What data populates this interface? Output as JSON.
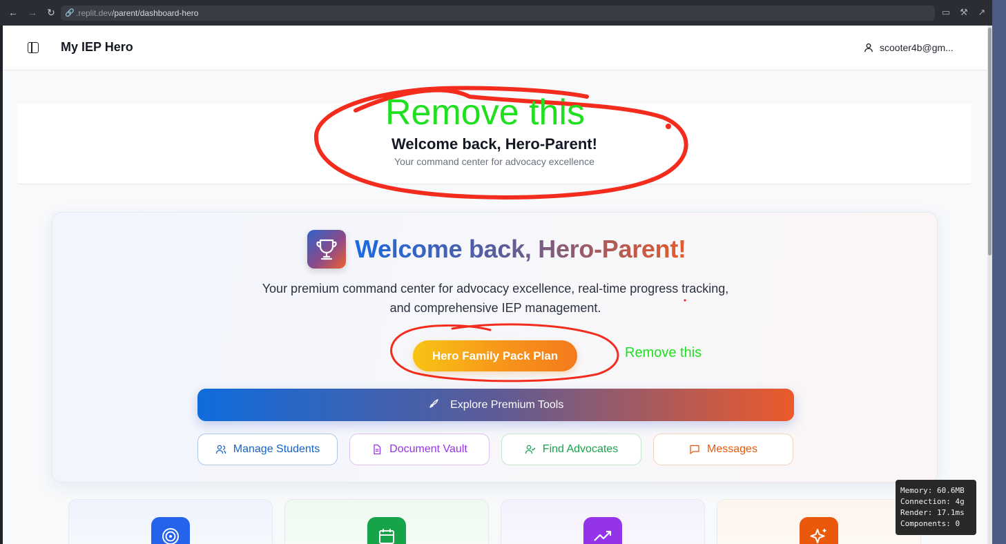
{
  "browser": {
    "url_domain": ".replit.dev",
    "url_path": "/parent/dashboard-hero"
  },
  "app": {
    "title": "My IEP Hero",
    "user_email": "scooter4b@gm..."
  },
  "header": {
    "title": "Welcome back, Hero-Parent!",
    "subtitle": "Your command center for advocacy excellence"
  },
  "hero": {
    "title": "Welcome back, Hero-Parent!",
    "description": "Your premium command center for advocacy excellence, real-time progress tracking, and comprehensive IEP management.",
    "plan_button": "Hero Family Pack Plan",
    "premium_button": "Explore Premium Tools",
    "quick_actions": [
      {
        "label": "Manage Students",
        "icon": "users-icon",
        "color": "#1463c8"
      },
      {
        "label": "Document Vault",
        "icon": "file-icon",
        "color": "#9333ea"
      },
      {
        "label": "Find Advocates",
        "icon": "user-check-icon",
        "color": "#16a34a"
      },
      {
        "label": "Messages",
        "icon": "message-icon",
        "color": "#ea580c"
      }
    ]
  },
  "feature_cards": [
    {
      "icon": "target-icon",
      "color": "#2563eb"
    },
    {
      "icon": "calendar-icon",
      "color": "#16a34a"
    },
    {
      "icon": "trending-up-icon",
      "color": "#9333ea"
    },
    {
      "icon": "sparkles-icon",
      "color": "#ea580c"
    }
  ],
  "dev_overlay": {
    "memory": "Memory: 60.6MB",
    "connection": "Connection: 4g",
    "render": "Render: 17.1ms",
    "components": "Components: 0"
  },
  "annotations": {
    "big": "Remove this",
    "small": "Remove this",
    "color": "#1fe01f"
  }
}
